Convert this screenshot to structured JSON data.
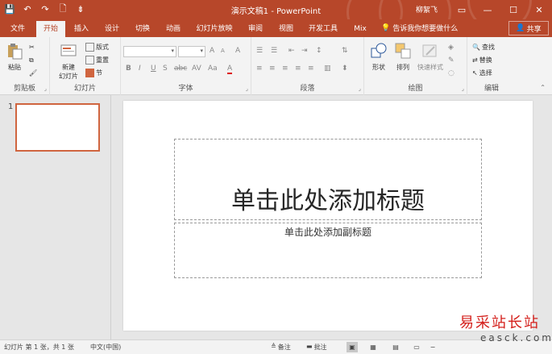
{
  "titlebar": {
    "title": "演示文稿1  -  PowerPoint",
    "user": "柳絮飞",
    "qat": {
      "save": "💾",
      "undo": "↶",
      "redo": "↷",
      "new": "🗋",
      "more": "⇟"
    },
    "win": {
      "ribbon_opts": "▭",
      "minimize": "—",
      "maximize": "☐",
      "close": "✕"
    }
  },
  "tabs": {
    "items": [
      "文件",
      "开始",
      "插入",
      "设计",
      "切换",
      "动画",
      "幻灯片放映",
      "审阅",
      "视图",
      "开发工具",
      "Mix"
    ],
    "active_index": 1,
    "tell_me": "告诉我你想要做什么",
    "share": "共享"
  },
  "ribbon": {
    "clipboard": {
      "label": "剪贴板",
      "paste": "粘贴"
    },
    "slides": {
      "label": "幻灯片",
      "new_slide_1": "新建",
      "new_slide_2": "幻灯片",
      "layout": "版式",
      "reset": "重置",
      "section": "节"
    },
    "font": {
      "label": "字体",
      "bold": "B",
      "italic": "I",
      "underline": "U",
      "strike": "S",
      "shadow": "abc",
      "spacing": "AV",
      "case": "Aa",
      "color": "A",
      "grow": "A",
      "shrink": "A",
      "clear": "A"
    },
    "paragraph": {
      "label": "段落"
    },
    "drawing": {
      "label": "绘图",
      "shape": "形状",
      "arrange": "排列",
      "quick_styles": "快速样式"
    },
    "editing": {
      "label": "编辑",
      "find": "查找",
      "replace": "替换",
      "select": "选择"
    }
  },
  "thumbs": {
    "slide_number": "1"
  },
  "slide": {
    "title_placeholder": "单击此处添加标题",
    "subtitle_placeholder": "单击此处添加副标题"
  },
  "status": {
    "slide_info": "幻灯片 第 1 张，共 1 张",
    "language": "中文(中国)",
    "notes": "备注",
    "comments": "批注"
  },
  "watermark": {
    "cn": "易采站长站",
    "en": "easck.com"
  },
  "colors": {
    "accent": "#b7472a",
    "thumb_border": "#d0653f"
  }
}
